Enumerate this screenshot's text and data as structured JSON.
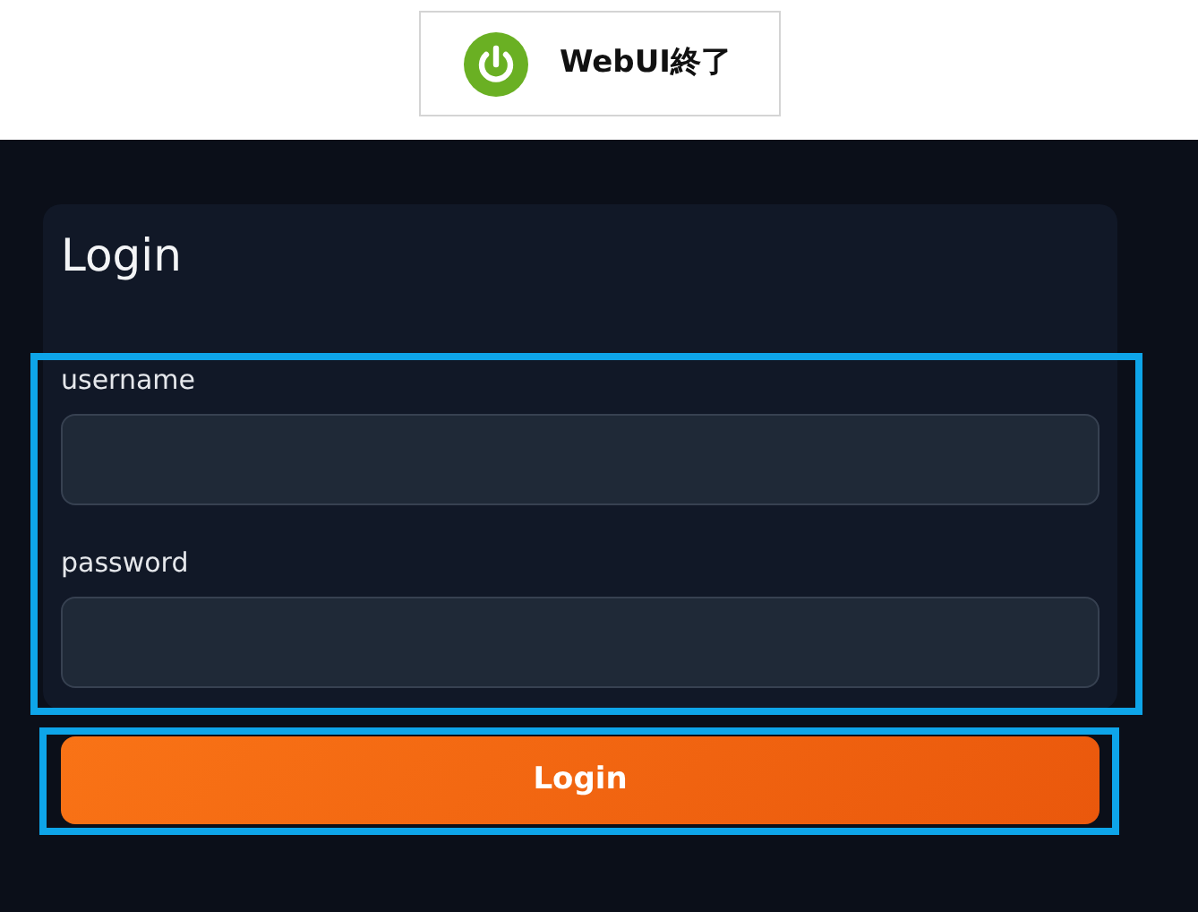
{
  "header": {
    "button": {
      "label": "WebUI終了"
    }
  },
  "login": {
    "title": "Login",
    "fields": [
      {
        "label": "username"
      },
      {
        "label": "password"
      }
    ],
    "submit": "Login"
  },
  "annotations": [
    {
      "kind": "frame"
    },
    {
      "kind": "frame"
    }
  ]
}
